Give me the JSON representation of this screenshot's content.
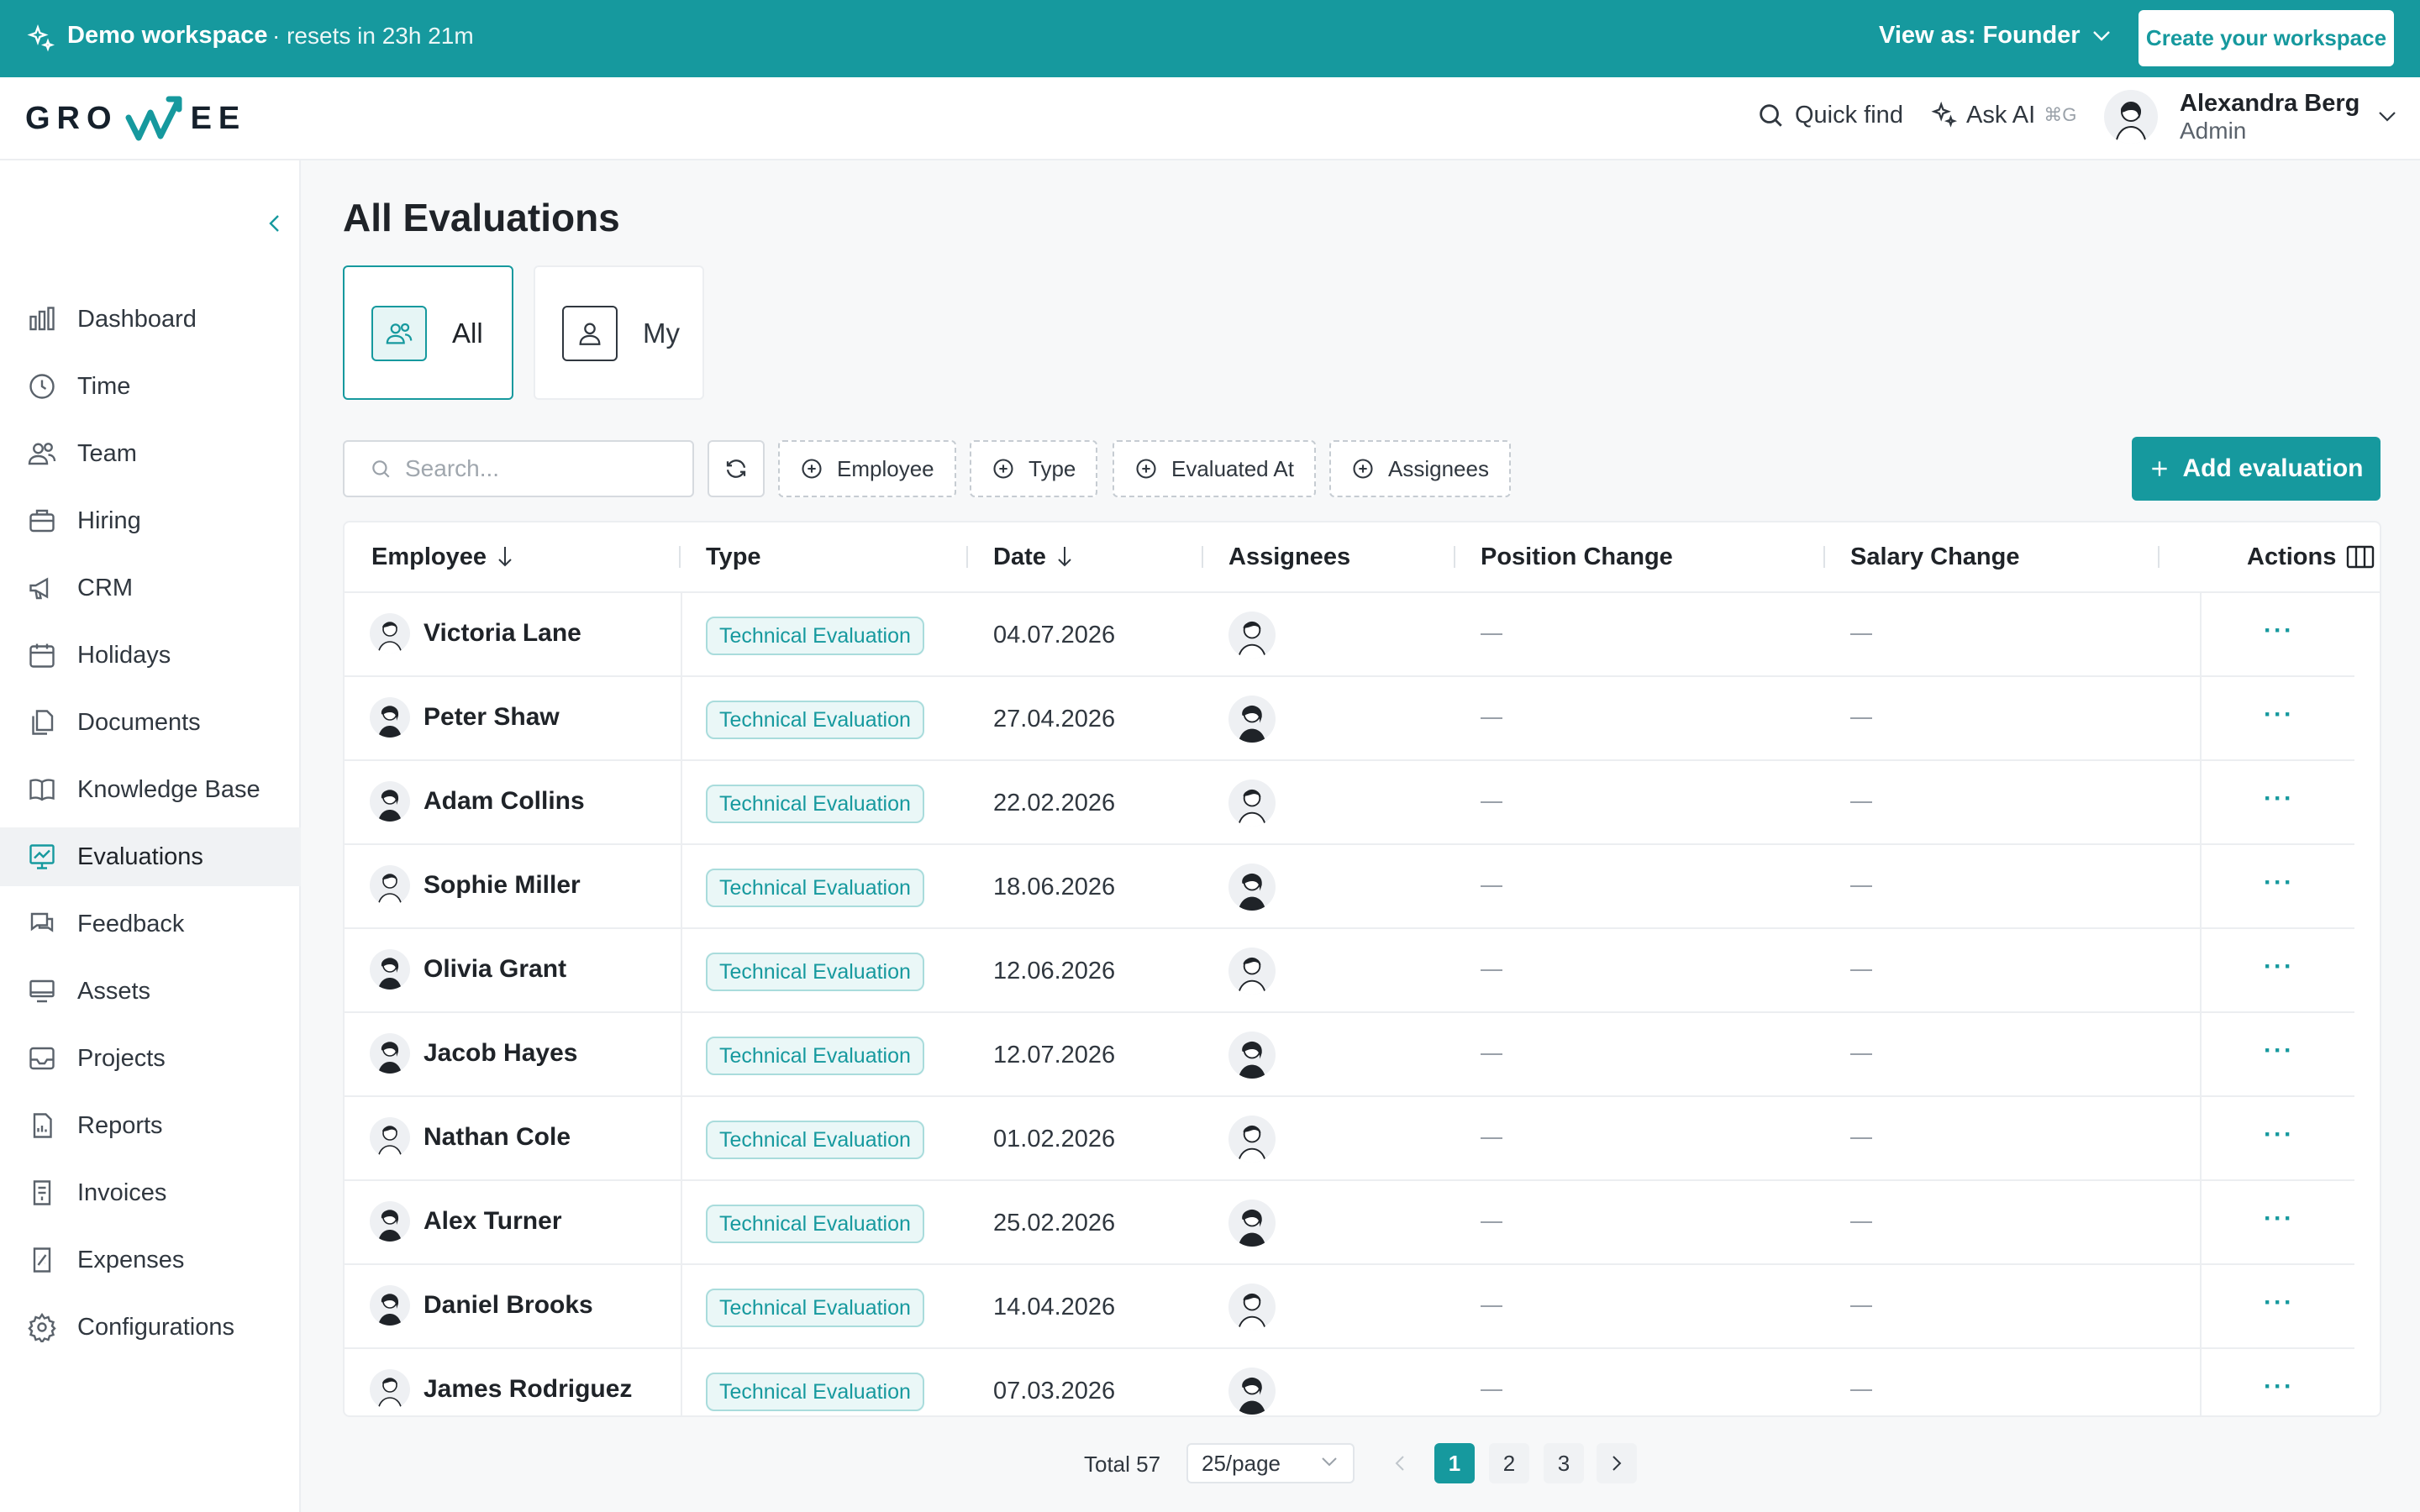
{
  "banner": {
    "workspace": "Demo workspace",
    "reset": "· resets in 23h 21m",
    "view_as": "View as: Founder",
    "cta": "Create your workspace"
  },
  "brand": {
    "left": "GRO",
    "right": "EE"
  },
  "header": {
    "quick_find": "Quick find",
    "ask_ai": "Ask AI",
    "ask_ai_shortcut": "⌘G",
    "user_name": "Alexandra Berg",
    "user_role": "Admin"
  },
  "sidebar": {
    "items": [
      {
        "label": "Dashboard",
        "icon": "chart-icon"
      },
      {
        "label": "Time",
        "icon": "clock-icon"
      },
      {
        "label": "Team",
        "icon": "users-icon"
      },
      {
        "label": "Hiring",
        "icon": "briefcase-icon"
      },
      {
        "label": "CRM",
        "icon": "megaphone-icon"
      },
      {
        "label": "Holidays",
        "icon": "calendar-icon"
      },
      {
        "label": "Documents",
        "icon": "documents-icon"
      },
      {
        "label": "Knowledge Base",
        "icon": "book-icon"
      },
      {
        "label": "Evaluations",
        "icon": "evaluations-icon"
      },
      {
        "label": "Feedback",
        "icon": "chat-icon"
      },
      {
        "label": "Assets",
        "icon": "monitor-icon"
      },
      {
        "label": "Projects",
        "icon": "inbox-icon"
      },
      {
        "label": "Reports",
        "icon": "report-icon"
      },
      {
        "label": "Invoices",
        "icon": "invoice-icon"
      },
      {
        "label": "Expenses",
        "icon": "expense-icon"
      },
      {
        "label": "Configurations",
        "icon": "gear-icon"
      }
    ],
    "active": "Evaluations"
  },
  "main": {
    "title": "All Evaluations",
    "tabs": [
      {
        "label": "All"
      },
      {
        "label": "My"
      }
    ],
    "search_placeholder": "Search...",
    "filters": [
      "Employee",
      "Type",
      "Evaluated At",
      "Assignees"
    ],
    "add_button": "Add evaluation"
  },
  "table": {
    "columns": [
      "Employee",
      "Type",
      "Date",
      "Assignees",
      "Position Change",
      "Salary Change",
      "Actions"
    ],
    "rows": [
      {
        "employee": "Victoria Lane",
        "type": "Technical Evaluation",
        "date": "04.07.2026",
        "position_change": "—",
        "salary_change": "—"
      },
      {
        "employee": "Peter Shaw",
        "type": "Technical Evaluation",
        "date": "27.04.2026",
        "position_change": "—",
        "salary_change": "—"
      },
      {
        "employee": "Adam Collins",
        "type": "Technical Evaluation",
        "date": "22.02.2026",
        "position_change": "—",
        "salary_change": "—"
      },
      {
        "employee": "Sophie Miller",
        "type": "Technical Evaluation",
        "date": "18.06.2026",
        "position_change": "—",
        "salary_change": "—"
      },
      {
        "employee": "Olivia Grant",
        "type": "Technical Evaluation",
        "date": "12.06.2026",
        "position_change": "—",
        "salary_change": "—"
      },
      {
        "employee": "Jacob Hayes",
        "type": "Technical Evaluation",
        "date": "12.07.2026",
        "position_change": "—",
        "salary_change": "—"
      },
      {
        "employee": "Nathan Cole",
        "type": "Technical Evaluation",
        "date": "01.02.2026",
        "position_change": "—",
        "salary_change": "—"
      },
      {
        "employee": "Alex Turner",
        "type": "Technical Evaluation",
        "date": "25.02.2026",
        "position_change": "—",
        "salary_change": "—"
      },
      {
        "employee": "Daniel Brooks",
        "type": "Technical Evaluation",
        "date": "14.04.2026",
        "position_change": "—",
        "salary_change": "—"
      },
      {
        "employee": "James Rodriguez",
        "type": "Technical Evaluation",
        "date": "07.03.2026",
        "position_change": "—",
        "salary_change": "—"
      }
    ],
    "row_action": "···"
  },
  "pagination": {
    "total": "Total 57",
    "page_size": "25/page",
    "pages": [
      "1",
      "2",
      "3"
    ],
    "current": "1"
  },
  "colors": {
    "accent": "#16999e",
    "text": "#1f2328",
    "muted": "#5a626b",
    "border": "#eceef1"
  }
}
